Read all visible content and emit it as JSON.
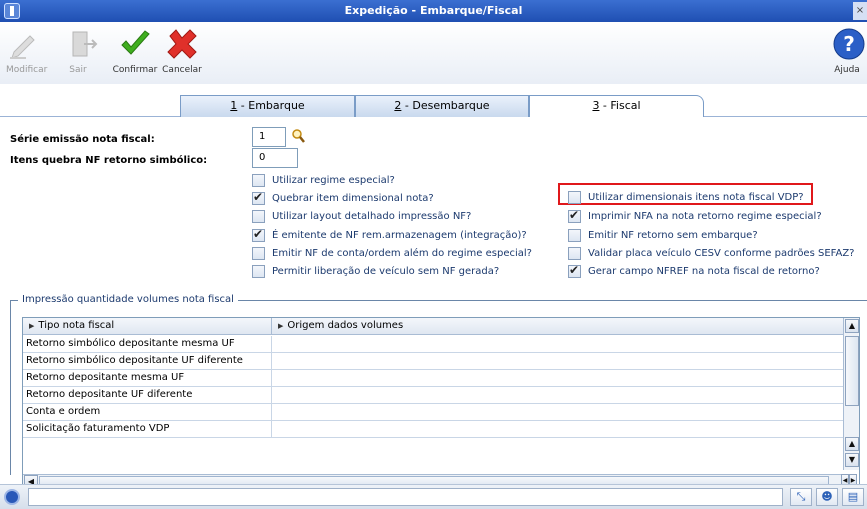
{
  "window": {
    "title": "Expedição - Embarque/Fiscal"
  },
  "toolbar": {
    "modificar": "Modificar",
    "sair": "Sair",
    "confirmar": "Confirmar",
    "cancelar": "Cancelar",
    "ajuda": "Ajuda"
  },
  "tabs": [
    {
      "key": "1",
      "label": " - Embarque"
    },
    {
      "key": "2",
      "label": " - Desembarque"
    },
    {
      "key": "3",
      "label": " - Fiscal"
    }
  ],
  "form": {
    "serie_label": "Série emissão nota fiscal:",
    "serie_value": "1",
    "itens_label": "Itens quebra NF retorno simbólico:",
    "itens_value": "0"
  },
  "checkboxes_left": [
    {
      "label": "Utilizar regime especial?",
      "checked": false
    },
    {
      "label": "Quebrar item dimensional nota?",
      "checked": true
    },
    {
      "label": "Utilizar layout detalhado impressão NF?",
      "checked": false
    },
    {
      "label": "É emitente de NF rem.armazenagem (integração)?",
      "checked": true
    },
    {
      "label": "Emitir NF de conta/ordem além do regime especial?",
      "checked": false
    },
    {
      "label": "Permitir liberação de veículo sem NF gerada?",
      "checked": false
    }
  ],
  "checkboxes_right": [
    {
      "label": "Utilizar dimensionais itens nota fiscal VDP?",
      "checked": false
    },
    {
      "label": "Imprimir NFA na nota retorno regime especial?",
      "checked": true
    },
    {
      "label": "Emitir NF retorno sem embarque?",
      "checked": false
    },
    {
      "label": "Validar placa veículo CESV conforme padrões SEFAZ?",
      "checked": false
    },
    {
      "label": "Gerar campo NFREF na nota fiscal de retorno?",
      "checked": true
    }
  ],
  "group": {
    "title": "Impressão quantidade volumes nota fiscal",
    "columns": [
      "Tipo nota fiscal",
      "Origem dados volumes"
    ],
    "rows": [
      [
        "Retorno simbólico depositante mesma UF",
        ""
      ],
      [
        "Retorno simbólico depositante UF diferente",
        ""
      ],
      [
        "Retorno depositante mesma UF",
        ""
      ],
      [
        "Retorno depositante UF diferente",
        ""
      ],
      [
        "Conta e ordem",
        ""
      ],
      [
        "Solicitação faturamento VDP",
        ""
      ]
    ]
  },
  "colors": {
    "accent": "#1f4fb2",
    "highlight": "#e0181b"
  },
  "icons": [
    "modificar-icon",
    "sair-icon",
    "confirmar-icon",
    "cancelar-icon",
    "ajuda-icon",
    "search-icon"
  ]
}
